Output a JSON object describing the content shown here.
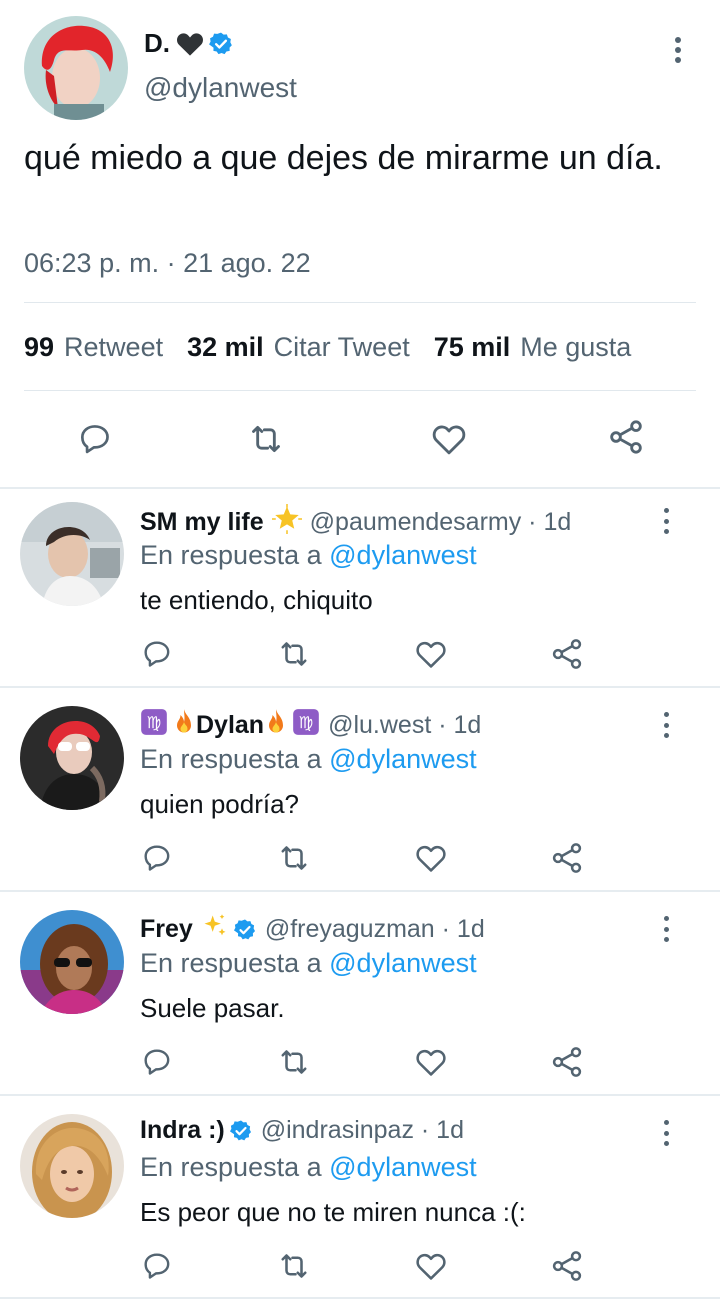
{
  "tweet": {
    "author_name": "D.",
    "author_handle": "@dylanwest",
    "text": "qué miedo a que dejes de mirarme un día.",
    "timestamp": "06:23 p. m. · 21 ago. 22",
    "stats": {
      "retweets_count": "99",
      "retweets_label": "Retweet",
      "quotes_count": "32 mil",
      "quotes_label": "Citar Tweet",
      "likes_count": "75 mil",
      "likes_label": "Me gusta"
    }
  },
  "replies": [
    {
      "name": "SM my life",
      "handle": "@paumendesarmy · 1d",
      "in_reply_prefix": "En respuesta a",
      "in_reply_handle": "@dylanwest",
      "text": "te entiendo, chiquito"
    },
    {
      "name": "Dylan",
      "handle": "@lu.west · 1d",
      "in_reply_prefix": "En respuesta a",
      "in_reply_handle": "@dylanwest",
      "text": "quien podría?"
    },
    {
      "name": "Frey",
      "handle": "@freyaguzman · 1d",
      "in_reply_prefix": "En respuesta a",
      "in_reply_handle": "@dylanwest",
      "text": "Suele pasar."
    },
    {
      "name": "Indra :)",
      "handle": "@indrasinpaz · 1d",
      "in_reply_prefix": "En respuesta a",
      "in_reply_handle": "@dylanwest",
      "text": "Es peor que no te miren nunca :(:"
    }
  ],
  "colors": {
    "verified": "#1d9bf0",
    "link": "#1d9bf0",
    "secondary_text": "#536471",
    "icon": "#536471"
  },
  "icons": [
    "reply-icon",
    "retweet-icon",
    "like-icon",
    "share-icon",
    "more-icon",
    "verified-badge-icon"
  ]
}
